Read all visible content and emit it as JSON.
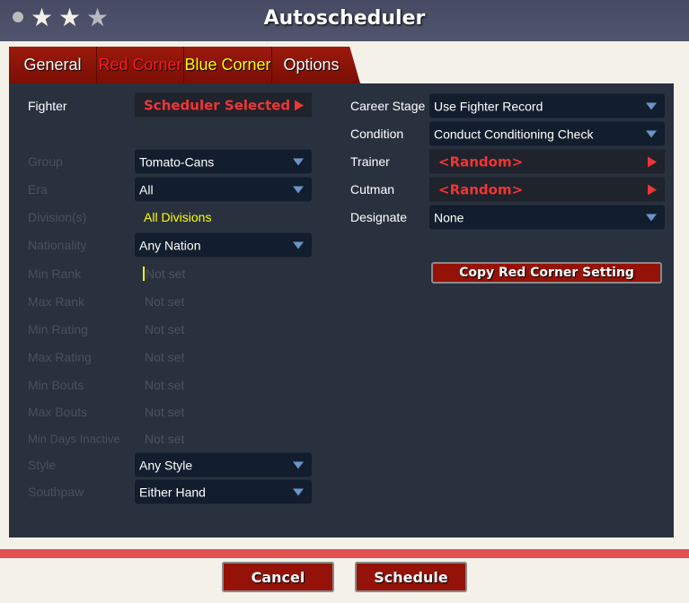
{
  "header": {
    "title": "Autoscheduler",
    "stars": [
      {
        "icon": "star-icon",
        "filled": true
      },
      {
        "icon": "star-icon",
        "filled": true
      },
      {
        "icon": "star-icon",
        "filled": false
      }
    ]
  },
  "tabs": [
    {
      "label": "General",
      "color": "#ffffff"
    },
    {
      "label": "Red Corner",
      "color": "#ff1a1a"
    },
    {
      "label": "Blue Corner",
      "color": "#ffff00"
    },
    {
      "label": "Options",
      "color": "#ffffff"
    }
  ],
  "left": {
    "fighter": {
      "label": "Fighter",
      "value": "Scheduler Selected"
    },
    "group": {
      "label": "Group",
      "value": "Tomato-Cans"
    },
    "era": {
      "label": "Era",
      "value": "All"
    },
    "division": {
      "label": "Division(s)",
      "value": "All Divisions"
    },
    "nationality": {
      "label": "Nationality",
      "value": "Any Nation"
    },
    "min_rank": {
      "label": "Min Rank",
      "placeholder": "Not set"
    },
    "max_rank": {
      "label": "Max Rank",
      "placeholder": "Not set"
    },
    "min_rating": {
      "label": "Min Rating",
      "placeholder": "Not set"
    },
    "max_rating": {
      "label": "Max Rating",
      "placeholder": "Not set"
    },
    "min_bouts": {
      "label": "Min Bouts",
      "placeholder": "Not set"
    },
    "max_bouts": {
      "label": "Max Bouts",
      "placeholder": "Not set"
    },
    "min_days_inactive": {
      "label": "Min Days Inactive",
      "placeholder": "Not set"
    },
    "style": {
      "label": "Style",
      "value": "Any Style"
    },
    "southpaw": {
      "label": "Southpaw",
      "value": "Either Hand"
    }
  },
  "right": {
    "career_stage": {
      "label": "Career Stage",
      "value": "Use Fighter Record"
    },
    "condition": {
      "label": "Condition",
      "value": "Conduct Conditioning Check"
    },
    "trainer": {
      "label": "Trainer",
      "value": "<Random>"
    },
    "cutman": {
      "label": "Cutman",
      "value": "<Random>"
    },
    "designate": {
      "label": "Designate",
      "value": "None"
    },
    "copy_button": "Copy Red Corner Setting"
  },
  "footer": {
    "cancel": "Cancel",
    "schedule": "Schedule"
  }
}
